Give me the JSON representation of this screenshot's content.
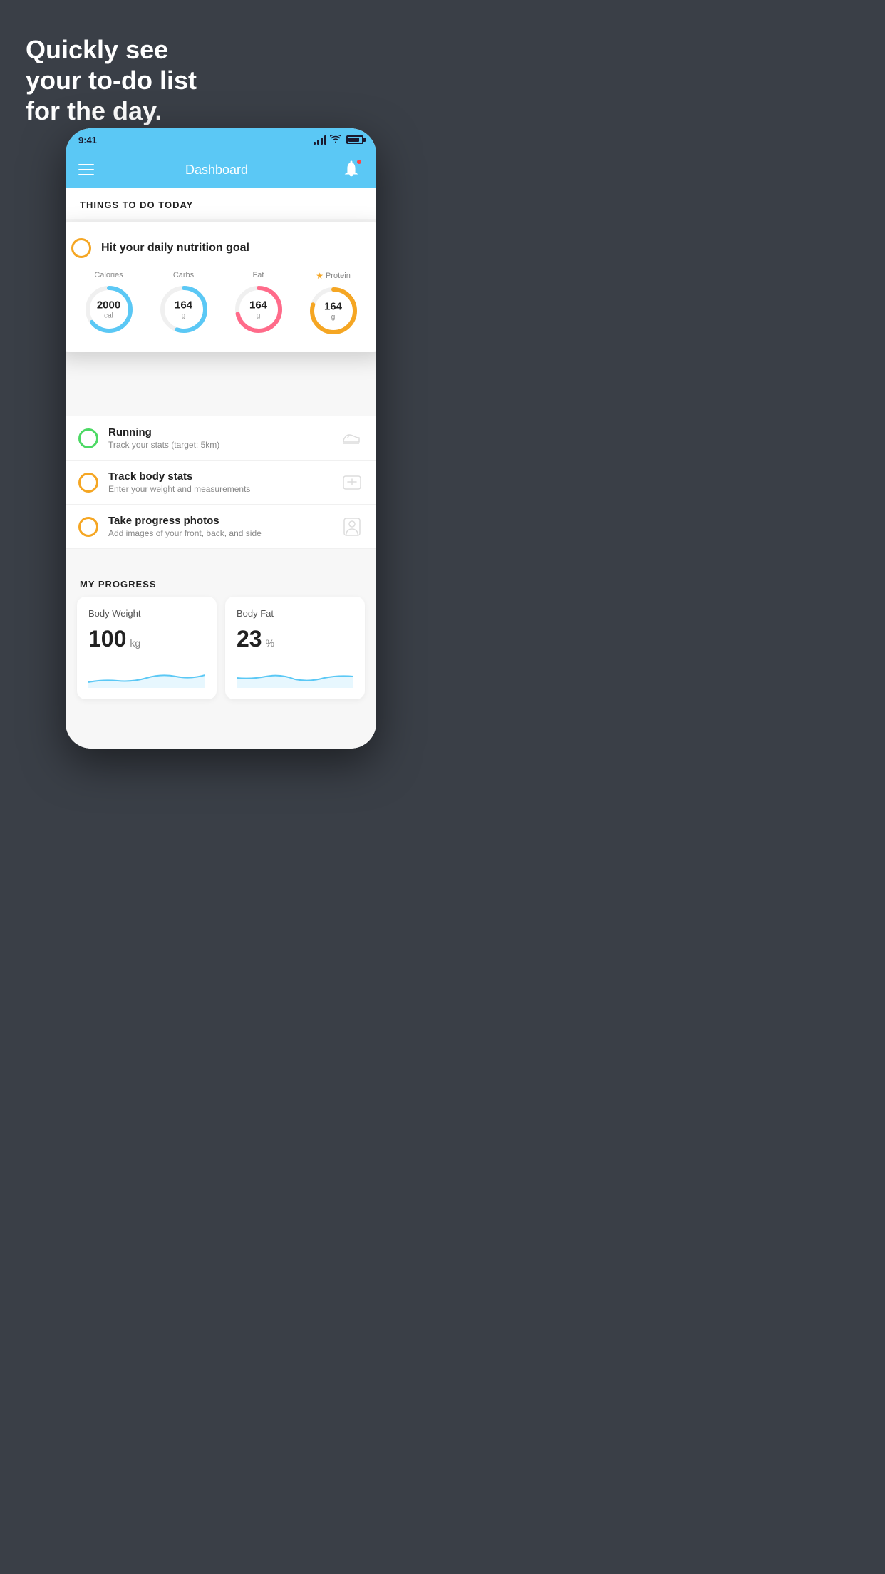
{
  "headline": {
    "line1": "Quickly see",
    "line2": "your to-do list",
    "line3": "for the day."
  },
  "status_bar": {
    "time": "9:41"
  },
  "nav": {
    "title": "Dashboard"
  },
  "section_title": "THINGS TO DO TODAY",
  "nutrition_card": {
    "title": "Hit your daily nutrition goal",
    "metrics": [
      {
        "label": "Calories",
        "value": "2000",
        "unit": "cal",
        "color": "#5bc8f5",
        "pct": 65
      },
      {
        "label": "Carbs",
        "value": "164",
        "unit": "g",
        "color": "#5bc8f5",
        "pct": 55
      },
      {
        "label": "Fat",
        "value": "164",
        "unit": "g",
        "color": "#ff6b8a",
        "pct": 72
      },
      {
        "label": "Protein",
        "value": "164",
        "unit": "g",
        "color": "#f5a623",
        "pct": 80,
        "star": true
      }
    ]
  },
  "todo_items": [
    {
      "title": "Running",
      "subtitle": "Track your stats (target: 5km)",
      "checkbox_color": "green",
      "icon": "shoe"
    },
    {
      "title": "Track body stats",
      "subtitle": "Enter your weight and measurements",
      "checkbox_color": "yellow",
      "icon": "scale"
    },
    {
      "title": "Take progress photos",
      "subtitle": "Add images of your front, back, and side",
      "checkbox_color": "yellow",
      "icon": "person"
    }
  ],
  "progress": {
    "section_title": "MY PROGRESS",
    "cards": [
      {
        "label": "Body Weight",
        "value": "100",
        "unit": "kg"
      },
      {
        "label": "Body Fat",
        "value": "23",
        "unit": "%"
      }
    ]
  }
}
